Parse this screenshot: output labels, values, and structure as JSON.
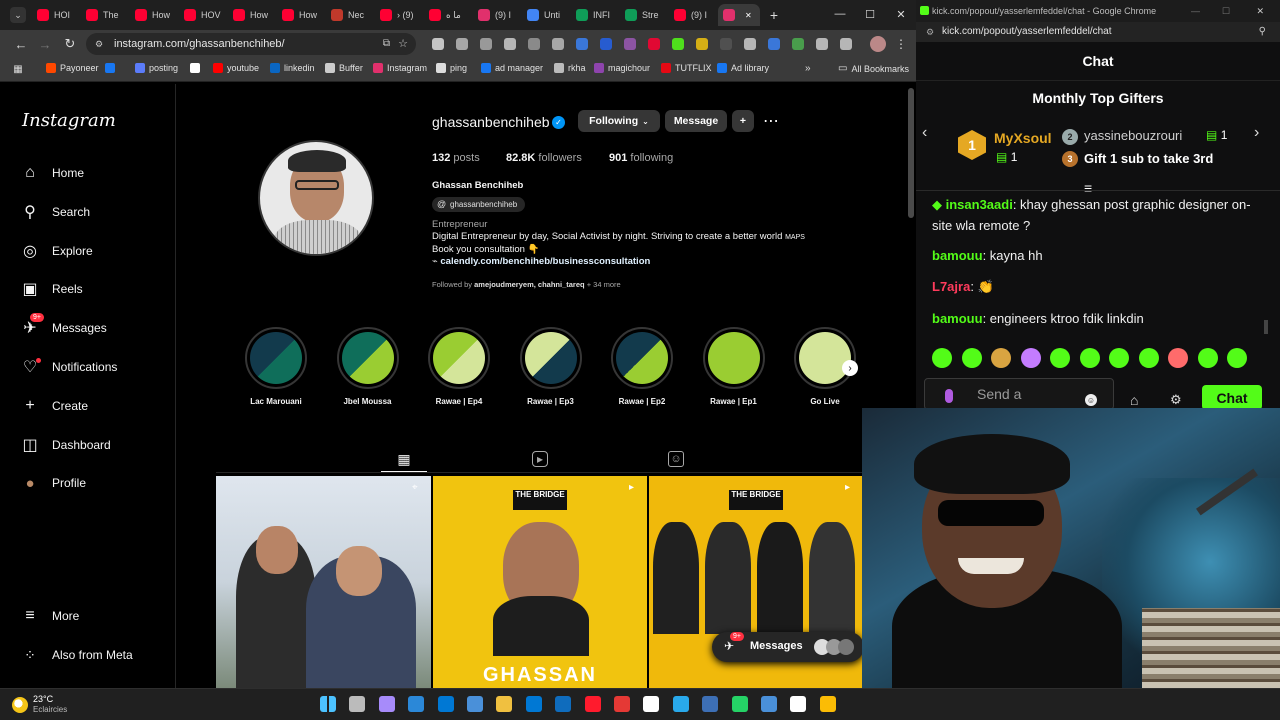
{
  "left_browser": {
    "tabs": [
      {
        "label": "HOI",
        "color": "#ff0033"
      },
      {
        "label": "The",
        "color": "#ff0033"
      },
      {
        "label": "How",
        "color": "#ff0033"
      },
      {
        "label": "HOV",
        "color": "#ff0033"
      },
      {
        "label": "How",
        "color": "#ff0033"
      },
      {
        "label": "How",
        "color": "#ff0033"
      },
      {
        "label": "Nec",
        "color": "#c0392b"
      },
      {
        "label": "› (9)",
        "color": "#ff0033"
      },
      {
        "label": "ما ه",
        "color": "#ff0033"
      },
      {
        "label": "(9) I",
        "color": "#e1306c"
      },
      {
        "label": "Unti",
        "color": "#4285f4"
      },
      {
        "label": "INFI",
        "color": "#0f9d58"
      },
      {
        "label": "Stre",
        "color": "#0f9d58"
      },
      {
        "label": "(9) I",
        "color": "#ff0033"
      },
      {
        "label": "",
        "color": "#e1306c"
      }
    ],
    "url": "instagram.com/ghassanbenchiheb/",
    "bookmarks": [
      {
        "label": "Payoneer",
        "color": "#ff4800"
      },
      {
        "label": "",
        "color": "#1877f2"
      },
      {
        "label": "posting",
        "color": "#5b7cfa"
      },
      {
        "label": "",
        "color": "#ffffff"
      },
      {
        "label": "youtube",
        "color": "#ff0000"
      },
      {
        "label": "linkedin",
        "color": "#0a66c2"
      },
      {
        "label": "Buffer",
        "color": "#cccccc"
      },
      {
        "label": "Instagram",
        "color": "#e1306c"
      },
      {
        "label": "ping",
        "color": "#dddddd"
      },
      {
        "label": "ad manager",
        "color": "#1877f2"
      },
      {
        "label": "rkha",
        "color": "#bbbbbb"
      },
      {
        "label": "magichour",
        "color": "#8e44ad"
      },
      {
        "label": "TUTFLIX",
        "color": "#e50914"
      },
      {
        "label": "Ad library",
        "color": "#1877f2"
      }
    ],
    "all_bookmarks": "All Bookmarks"
  },
  "instagram": {
    "logo": "Instagram",
    "nav": [
      {
        "label": "Home",
        "icon": "home-icon"
      },
      {
        "label": "Search",
        "icon": "search-icon"
      },
      {
        "label": "Explore",
        "icon": "compass-icon"
      },
      {
        "label": "Reels",
        "icon": "reels-icon"
      },
      {
        "label": "Messages",
        "icon": "messenger-icon",
        "badge": "9+"
      },
      {
        "label": "Notifications",
        "icon": "heart-icon"
      },
      {
        "label": "Create",
        "icon": "plus-icon"
      },
      {
        "label": "Dashboard",
        "icon": "chart-icon"
      },
      {
        "label": "Profile",
        "icon": "avatar-icon"
      }
    ],
    "more": "More",
    "also_from_meta": "Also from Meta",
    "profile": {
      "username": "ghassanbenchiheb",
      "following_btn": "Following",
      "message_btn": "Message",
      "posts": "132",
      "posts_label": "posts",
      "followers": "82.8K",
      "followers_label": "followers",
      "following": "901",
      "following_label": "following",
      "full_name": "Ghassan Benchiheb",
      "threads_handle": "ghassanbenchiheb",
      "category": "Entrepreneur",
      "bio_line1": "Digital Entrepreneur by day, Social Activist by night. Striving to create a better world",
      "bio_maps": "MAPS",
      "bio_line2": "Book you consultation 👇",
      "link": "calendly.com/benchiheb/businessconsultation",
      "followed_by_prefix": "Followed by",
      "followed_by_names": "amejoudmeryem, chahni_tareq",
      "followed_by_more": "+ 34 more"
    },
    "highlights": [
      {
        "label": "Lac Marouani",
        "c1": "#123a4c",
        "c2": "#0f6e5a"
      },
      {
        "label": "Jbel Moussa",
        "c1": "#0f6e5a",
        "c2": "#9acd32"
      },
      {
        "label": "Rawae | Ep4",
        "c1": "#9acd32",
        "c2": "#d4e59a"
      },
      {
        "label": "Rawae | Ep3",
        "c1": "#d4e59a",
        "c2": "#123a4c"
      },
      {
        "label": "Rawae | Ep2",
        "c1": "#123a4c",
        "c2": "#9acd32"
      },
      {
        "label": "Rawae | Ep1",
        "c1": "#9acd32",
        "c2": "#9acd32"
      },
      {
        "label": "Go Live",
        "c1": "#d4e59a",
        "c2": "#d4e59a"
      }
    ],
    "post_brand": "THE BRIDGE",
    "post_name": "GHASSAN",
    "messages_float": "Messages",
    "messages_badge": "9+"
  },
  "kick": {
    "window_title": "kick.com/popout/yasserlemfeddel/chat - Google Chrome",
    "url": "kick.com/popout/yasserlemfeddel/chat",
    "chat_header": "Chat",
    "gifters_title": "Monthly Top Gifters",
    "gifter1_name": "MyXsoul",
    "gifter1_count": "1",
    "gifter1_rank": "1",
    "gifter2_name": "yassinebouzrouri",
    "gifter2_count": "1",
    "gifter2_rank": "2",
    "gift_cta": "Gift 1 sub to take 3rd",
    "gift_rank": "3",
    "messages": [
      {
        "user": "insan3aadi",
        "user_color": "#53fc18",
        "text": "khay ghessan post graphic designer on-site wla remote ?"
      },
      {
        "user": "bamouu",
        "user_color": "#53fc18",
        "text": "kayna hh"
      },
      {
        "user": "L7ajra",
        "user_color": "#ff3b5c",
        "text": ""
      },
      {
        "user": "bamouu",
        "user_color": "#53fc18",
        "text": "engineers ktroo fdik linkdin"
      }
    ],
    "input_placeholder": "Send a",
    "chat_button": "Chat",
    "accent": "#53fc18"
  },
  "taskbar": {
    "weather_temp": "23°C",
    "weather_desc": "Eclaircies"
  }
}
